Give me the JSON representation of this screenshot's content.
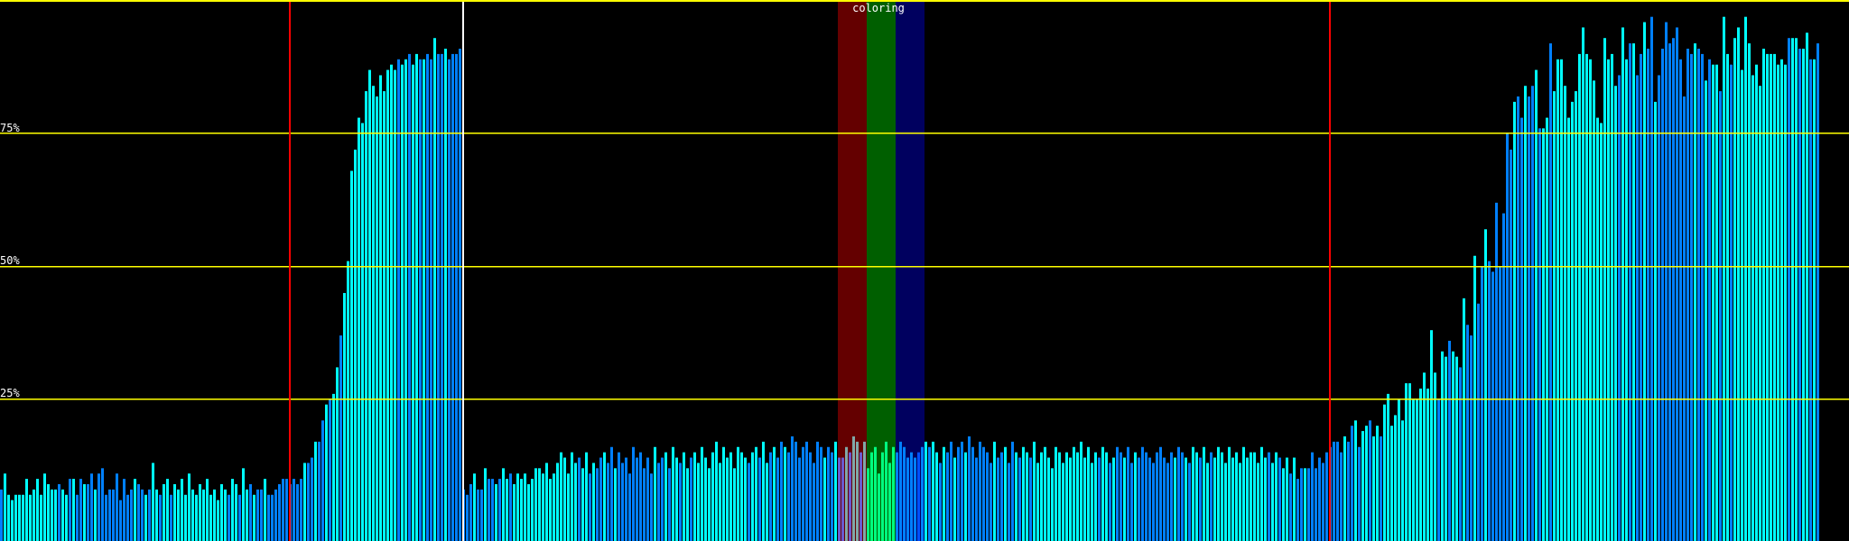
{
  "chart_data": {
    "type": "bar",
    "title": "coloring",
    "xlabel": "",
    "ylabel": "",
    "ylim": [
      0,
      100
    ],
    "y_ticks": [
      {
        "value": 75,
        "label": "75%"
      },
      {
        "value": 50,
        "label": "50%"
      },
      {
        "value": 25,
        "label": "25%"
      }
    ],
    "grid": true,
    "bar_count": 512,
    "markers": {
      "red_bar_indices": [
        80,
        368
      ],
      "white_bar_index": 128,
      "coloring_bands": [
        {
          "name": "red",
          "from": 232,
          "to": 240,
          "color": "#640000"
        },
        {
          "name": "green",
          "from": 240,
          "to": 248,
          "color": "#005f00"
        },
        {
          "name": "blue",
          "from": 248,
          "to": 256,
          "color": "#00005f"
        }
      ]
    },
    "colors": {
      "grid": "#ffff00",
      "red_marker": "#ff0000",
      "white_marker": "#ffffff",
      "bar_a": "#00ffff",
      "bar_b": "#0080ff",
      "red_band_a": "#80a8a8",
      "red_band_b": "#6a5ad0",
      "green_band_a": "#00ff80",
      "green_band_b": "#00c0a0",
      "blue_band_a": "#0080ff",
      "blue_band_b": "#0050ff"
    },
    "values": [
      8,
      11,
      7,
      6,
      7,
      7,
      7,
      10,
      7,
      8,
      10,
      7,
      11,
      9,
      8,
      8,
      9,
      8,
      7,
      10,
      10,
      7,
      10,
      9,
      9,
      11,
      8,
      11,
      12,
      7,
      8,
      8,
      11,
      6,
      10,
      7,
      8,
      10,
      9,
      8,
      7,
      8,
      13,
      8,
      7,
      9,
      10,
      7,
      9,
      8,
      10,
      7,
      11,
      8,
      7,
      9,
      8,
      10,
      7,
      8,
      6,
      9,
      8,
      7,
      10,
      9,
      7,
      12,
      8,
      9,
      7,
      8,
      8,
      10,
      7,
      7,
      8,
      9,
      10,
      10,
      9,
      10,
      9,
      10,
      13,
      13,
      14,
      17,
      17,
      21,
      24,
      25,
      26,
      31,
      37,
      45,
      51,
      68,
      72,
      78,
      77,
      83,
      87,
      84,
      82,
      86,
      83,
      87,
      88,
      87,
      89,
      88,
      89,
      90,
      88,
      90,
      89,
      89,
      90,
      89,
      93,
      90,
      90,
      91,
      89,
      90,
      90,
      91,
      8,
      7,
      9,
      11,
      8,
      8,
      12,
      10,
      10,
      9,
      10,
      12,
      10,
      11,
      9,
      11,
      10,
      11,
      9,
      10,
      12,
      12,
      11,
      13,
      10,
      11,
      13,
      15,
      14,
      11,
      15,
      13,
      14,
      12,
      15,
      11,
      13,
      12,
      14,
      15,
      13,
      16,
      12,
      15,
      13,
      14,
      11,
      16,
      14,
      15,
      12,
      14,
      11,
      16,
      13,
      14,
      15,
      12,
      16,
      14,
      13,
      15,
      12,
      14,
      15,
      13,
      16,
      14,
      12,
      15,
      17,
      13,
      16,
      14,
      15,
      12,
      16,
      15,
      14,
      13,
      15,
      16,
      14,
      17,
      13,
      15,
      16,
      14,
      17,
      16,
      15,
      18,
      17,
      14,
      16,
      17,
      15,
      13,
      17,
      16,
      14,
      16,
      15,
      17,
      14,
      14,
      16,
      15,
      18,
      17,
      15,
      17,
      12,
      15,
      16,
      11,
      15,
      17,
      13,
      16,
      15,
      17,
      16,
      14,
      15,
      14,
      15,
      16,
      17,
      16,
      17,
      15,
      13,
      16,
      15,
      17,
      14,
      16,
      17,
      15,
      18,
      16,
      14,
      17,
      16,
      15,
      13,
      17,
      14,
      15,
      16,
      13,
      17,
      15,
      14,
      16,
      15,
      14,
      17,
      13,
      15,
      16,
      14,
      12,
      16,
      15,
      13,
      15,
      14,
      16,
      15,
      17,
      14,
      16,
      13,
      15,
      14,
      16,
      15,
      13,
      14,
      16,
      15,
      14,
      16,
      13,
      15,
      14,
      16,
      15,
      14,
      13,
      15,
      16,
      14,
      13,
      15,
      14,
      16,
      15,
      14,
      13,
      16,
      15,
      14,
      16,
      13,
      15,
      14,
      16,
      15,
      13,
      16,
      14,
      15,
      13,
      16,
      14,
      15,
      15,
      13,
      16,
      14,
      15,
      13,
      15,
      14,
      12,
      14,
      11,
      14,
      10,
      12,
      12,
      12,
      15,
      12,
      14,
      13,
      15,
      16,
      17,
      17,
      15,
      18,
      17,
      20,
      21,
      16,
      19,
      20,
      21,
      18,
      20,
      18,
      24,
      26,
      20,
      22,
      25,
      21,
      28,
      28,
      25,
      25,
      27,
      30,
      27,
      38,
      30,
      25,
      34,
      33,
      36,
      34,
      33,
      31,
      44,
      39,
      37,
      52,
      43,
      50,
      57,
      51,
      49,
      62,
      50,
      60,
      75,
      72,
      81,
      82,
      78,
      84,
      82,
      84,
      87,
      76,
      76,
      78,
      92,
      83,
      89,
      89,
      84,
      78,
      81,
      83,
      90,
      95,
      90,
      89,
      85,
      78,
      77,
      93,
      89,
      90,
      84,
      86,
      95,
      89,
      92,
      92,
      86,
      90,
      96,
      91,
      97,
      81,
      86,
      91,
      96,
      92,
      93,
      95,
      89,
      82,
      91,
      90,
      92,
      91,
      90,
      85,
      89,
      88,
      88,
      83,
      97,
      90,
      88,
      93,
      95,
      87,
      97,
      92,
      86,
      88,
      84,
      91,
      90,
      90,
      90,
      88,
      89,
      88,
      93,
      93,
      93,
      91,
      91,
      94,
      89,
      89,
      92
    ]
  }
}
